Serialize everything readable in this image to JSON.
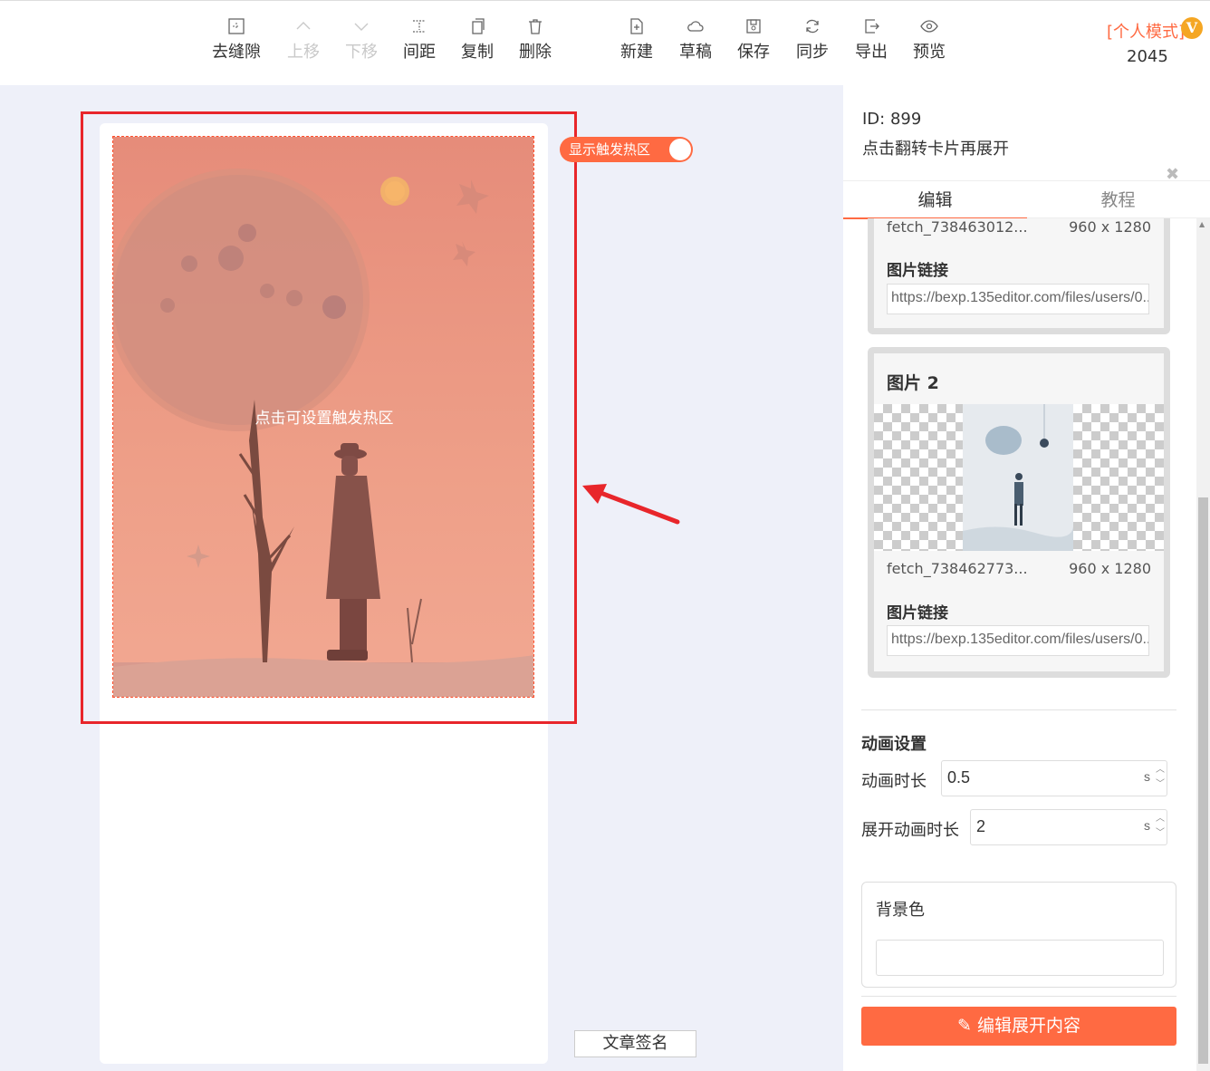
{
  "toolbar": {
    "items": [
      {
        "label": "去缝隙",
        "icon": "no-gap-icon"
      },
      {
        "label": "上移",
        "icon": "chevron-up-icon"
      },
      {
        "label": "下移",
        "icon": "chevron-down-icon"
      },
      {
        "label": "间距",
        "icon": "spacing-icon"
      },
      {
        "label": "复制",
        "icon": "copy-icon"
      },
      {
        "label": "删除",
        "icon": "trash-icon"
      },
      {
        "label": "新建",
        "icon": "new-file-icon"
      },
      {
        "label": "草稿",
        "icon": "cloud-icon"
      },
      {
        "label": "保存",
        "icon": "save-icon"
      },
      {
        "label": "同步",
        "icon": "sync-icon"
      },
      {
        "label": "导出",
        "icon": "export-icon"
      },
      {
        "label": "预览",
        "icon": "eye-icon"
      }
    ],
    "mode_label": "[个人模式]",
    "vip_badge": "V",
    "mode_number": "2045"
  },
  "canvas": {
    "hotzone_text": "点击可设置触发热区",
    "toggle_label": "显示触发热区",
    "signature_button": "文章签名"
  },
  "panel": {
    "id_text": "ID: 899",
    "description": "点击翻转卡片再展开",
    "tabs": [
      "编辑",
      "教程"
    ],
    "image1": {
      "file_name": "fetch_738463012...",
      "size": "960 x 1280",
      "link_label": "图片链接",
      "link_value": "https://bexp.135editor.com/files/users/0..."
    },
    "image2": {
      "title": "图片 2",
      "file_name": "fetch_738462773...",
      "size": "960 x 1280",
      "link_label": "图片链接",
      "link_value": "https://bexp.135editor.com/files/users/0..."
    },
    "animation": {
      "section_title": "动画设置",
      "duration_label": "动画时长",
      "duration_value": "0.5",
      "expand_label": "展开动画时长",
      "expand_value": "2",
      "unit": "s"
    },
    "bg_color_label": "背景色",
    "edit_button": "编辑展开内容"
  },
  "colors": {
    "accent": "#ff6a42",
    "highlight": "#e8262b"
  }
}
